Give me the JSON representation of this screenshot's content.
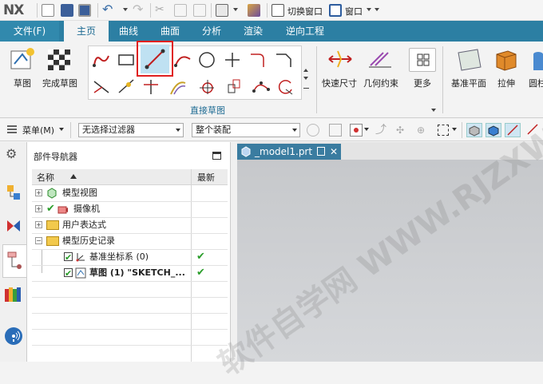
{
  "app": {
    "logo": "NX"
  },
  "quickbar": {
    "switch_window": "切换窗口",
    "window": "窗口"
  },
  "tabs": {
    "file": "文件(F)",
    "items": [
      "主页",
      "曲线",
      "曲面",
      "分析",
      "渲染",
      "逆向工程"
    ],
    "active": "主页"
  },
  "ribbon": {
    "sketch": "草图",
    "finish_sketch": "完成草图",
    "group_label": "直接草图",
    "quick_dimension": "快速尺寸",
    "geometric_constraint": "几何约束",
    "more": "更多",
    "datum_plane": "基准平面",
    "extrude": "拉伸",
    "cylinder_partial": "圆柱"
  },
  "toolbar2": {
    "menu": "菜单(M)",
    "filter": "无选择过滤器",
    "assembly_scope": "整个装配"
  },
  "navigator": {
    "title": "部件导航器",
    "col_name": "名称",
    "col_latest": "最新",
    "items": [
      {
        "label": "模型视图",
        "indent": 0,
        "expander": "+",
        "checked": false,
        "latest": ""
      },
      {
        "label": "摄像机",
        "indent": 0,
        "expander": "+",
        "checked": true,
        "latest": ""
      },
      {
        "label": "用户表达式",
        "indent": 0,
        "expander": "+",
        "checked": false,
        "latest": ""
      },
      {
        "label": "模型历史记录",
        "indent": 0,
        "expander": "−",
        "checked": false,
        "latest": ""
      },
      {
        "label": "基准坐标系 (0)",
        "indent": 1,
        "expander": "",
        "checked": true,
        "latest": "✔"
      },
      {
        "label": "草图 (1) \"SKETCH_...",
        "indent": 1,
        "expander": "",
        "checked": true,
        "latest": "✔"
      }
    ]
  },
  "document": {
    "tab_label": "_model1.prt"
  },
  "watermark": "软件自学网 WWW.RJZXW.COM",
  "colors": {
    "tab_bar": "#2c7fa3",
    "accent_blue": "#1e6b93",
    "highlight": "#e02020",
    "check_green": "#2a9d2a"
  }
}
